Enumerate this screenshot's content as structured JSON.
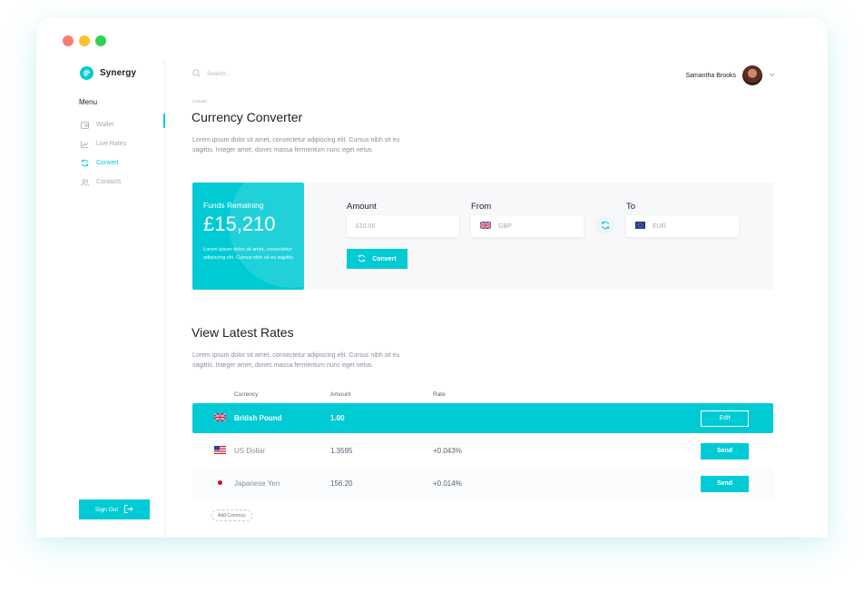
{
  "window": {
    "controls": [
      "close",
      "minimize",
      "maximize"
    ]
  },
  "brand": {
    "name": "Synergy",
    "icon": "synergy-logo-icon"
  },
  "sidebar": {
    "menu_label": "Menu",
    "items": [
      {
        "label": "Wallet",
        "icon": "wallet-icon"
      },
      {
        "label": "Live Rates",
        "icon": "chart-line-icon"
      },
      {
        "label": "Convert",
        "icon": "refresh-icon",
        "active": true
      },
      {
        "label": "Contacts",
        "icon": "people-icon"
      }
    ],
    "signout_label": "Sign Out"
  },
  "topbar": {
    "search_placeholder": "Search...",
    "user_name": "Samantha Brooks"
  },
  "page": {
    "breadcrumb": "Convert",
    "title": "Currency Converter",
    "description": "Lorem ipsum dolor sit amet, consectetur adipiscing elit. Cursus nibh sit eu sagittis. Integer amet, donec massa fermentum nunc eget netus."
  },
  "funds": {
    "label": "Funds Remaining",
    "amount": "£15,210",
    "note": "Lorem ipsum dolor sit amet, consectetur adipiscing elit. Cursus nibh sit eu sagittis."
  },
  "converter": {
    "amount_label": "Amount",
    "amount_placeholder": "£10.00",
    "from_label": "From",
    "from_value": "GBP",
    "to_label": "To",
    "to_value": "EUR",
    "convert_label": "Convert"
  },
  "rates": {
    "title": "View Latest Rates",
    "description": "Lorem ipsum dolor sit amet, consectetur adipiscing elit. Cursus nibh sit eu sagittis. Integer amet, donec massa fermentum nunc eget netus.",
    "columns": [
      "Currency",
      "Amount",
      "Rate"
    ],
    "rows": [
      {
        "currency": "British Pound",
        "amount": "1.00",
        "rate": "",
        "action": "Edit",
        "flag": "uk-flag-icon"
      },
      {
        "currency": "US Dollar",
        "amount": "1.3595",
        "rate": "+0.043%",
        "action": "Send",
        "flag": "us-flag-icon"
      },
      {
        "currency": "Japanese Yen",
        "amount": "156.20",
        "rate": "+0.014%",
        "action": "Send",
        "flag": "japan-flag-icon"
      }
    ],
    "add_label": "Add Currency"
  },
  "colors": {
    "accent": "#00cbd5",
    "text": "#1c1e2a",
    "muted": "#a3a8b6"
  }
}
